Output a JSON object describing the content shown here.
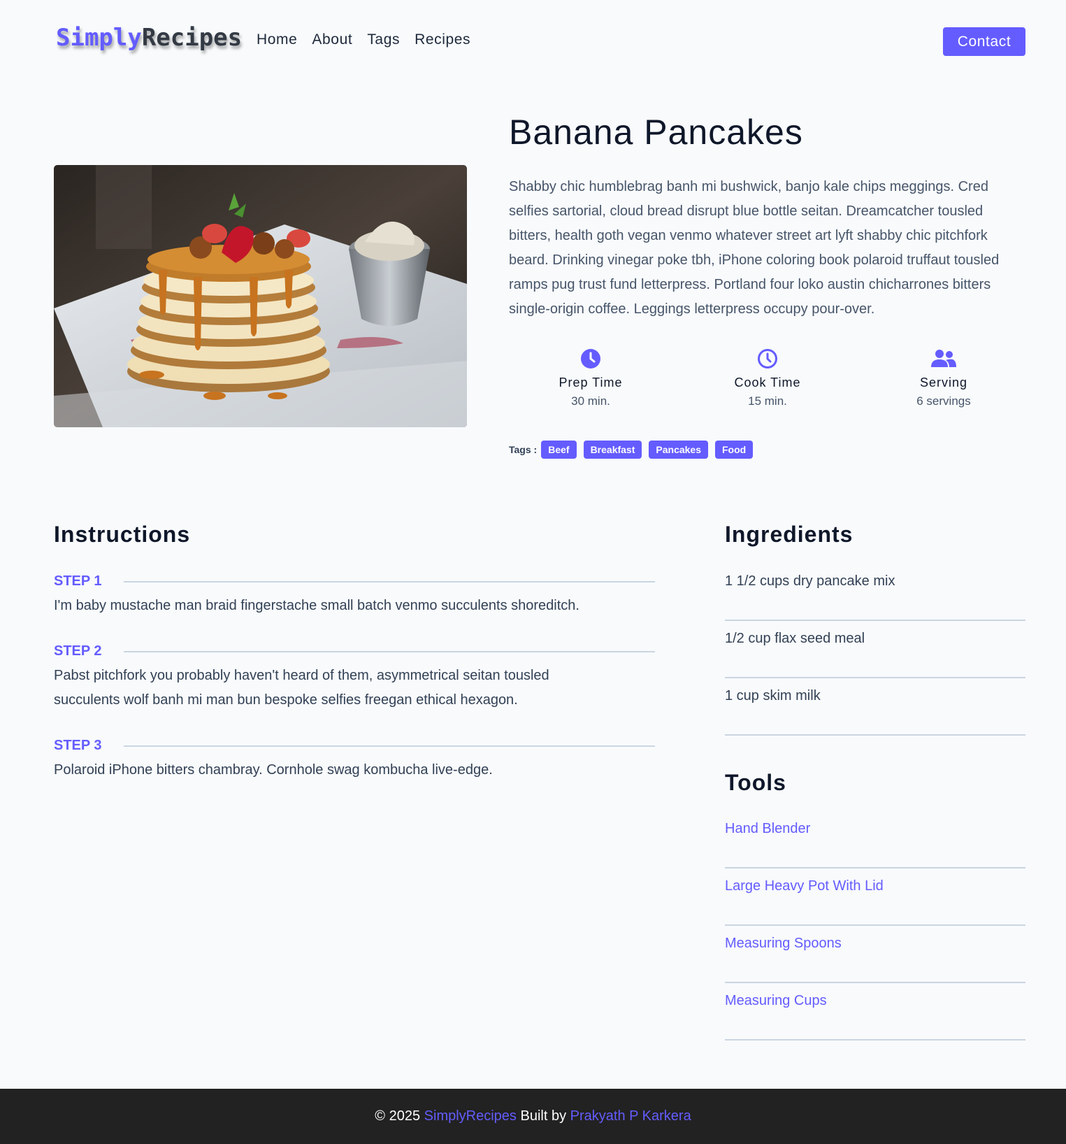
{
  "nav": {
    "logo_part1": "Simply",
    "logo_part2": "Recipes",
    "links": [
      "Home",
      "About",
      "Tags",
      "Recipes"
    ],
    "contact_label": "Contact"
  },
  "recipe": {
    "title": "Banana Pancakes",
    "description": "Shabby chic humblebrag banh mi bushwick, banjo kale chips meggings. Cred selfies sartorial, cloud bread disrupt blue bottle seitan. Dreamcatcher tousled bitters, health goth vegan venmo whatever street art lyft shabby chic pitchfork beard. Drinking vinegar poke tbh, iPhone coloring book polaroid truffaut tousled ramps pug trust fund letterpress. Portland four loko austin chicharrones bitters single-origin coffee. Leggings letterpress occupy pour-over.",
    "stats": [
      {
        "label": "Prep Time",
        "value": "30 min.",
        "icon": "clock-filled-icon"
      },
      {
        "label": "Cook Time",
        "value": "15 min.",
        "icon": "clock-outline-icon"
      },
      {
        "label": "Serving",
        "value": "6 servings",
        "icon": "users-icon"
      }
    ],
    "tags_label": "Tags :",
    "tags": [
      "Beef",
      "Breakfast",
      "Pancakes",
      "Food"
    ]
  },
  "instructions": {
    "title": "Instructions",
    "steps": [
      {
        "label": "STEP 1",
        "text": "I'm baby mustache man braid fingerstache small batch venmo succulents shoreditch."
      },
      {
        "label": "STEP 2",
        "text": "Pabst pitchfork you probably haven't heard of them, asymmetrical seitan tousled succulents wolf banh mi man bun bespoke selfies freegan ethical hexagon."
      },
      {
        "label": "STEP 3",
        "text": "Polaroid iPhone bitters chambray. Cornhole swag kombucha live-edge."
      }
    ]
  },
  "ingredients": {
    "title": "Ingredients",
    "items": [
      "1 1/2 cups dry pancake mix",
      "1/2 cup flax seed meal",
      "1 cup skim milk"
    ]
  },
  "tools": {
    "title": "Tools",
    "items": [
      "Hand Blender",
      "Large Heavy Pot With Lid",
      "Measuring Spoons",
      "Measuring Cups"
    ]
  },
  "footer": {
    "prefix": "© 2025",
    "brand": "SimplyRecipes",
    "middle": "Built by",
    "author": "Prakyath P Karkera"
  },
  "colors": {
    "accent": "#645cff",
    "footer_bg": "#222222",
    "page_bg": "#f8fafc"
  }
}
